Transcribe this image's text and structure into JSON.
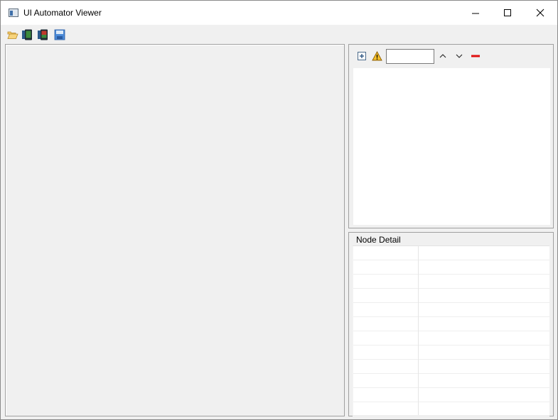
{
  "window": {
    "title": "UI Automator Viewer",
    "icon": "app-window-icon"
  },
  "window_controls": {
    "minimize_icon": "minimize-icon",
    "maximize_icon": "maximize-icon",
    "close_icon": "close-icon"
  },
  "toolbar": {
    "items": [
      {
        "name": "open-icon",
        "color": "#e8b24a"
      },
      {
        "name": "device-screenshot-icon",
        "color": "#3c8a3c"
      },
      {
        "name": "device-screenshot-compressed-icon",
        "color": "#c0392b"
      },
      {
        "name": "save-icon",
        "color": "#3b7fd4"
      }
    ]
  },
  "hierarchy": {
    "expand_icon": "expand-all-icon",
    "warning_icon": "warning-icon",
    "filter_value": "",
    "filter_placeholder": "",
    "prev_icon": "chevron-up-icon",
    "next_icon": "chevron-down-icon",
    "clear_icon": "remove-icon",
    "clear_color": "#e01010"
  },
  "node_detail": {
    "label": "Node Detail",
    "rows": 12
  }
}
